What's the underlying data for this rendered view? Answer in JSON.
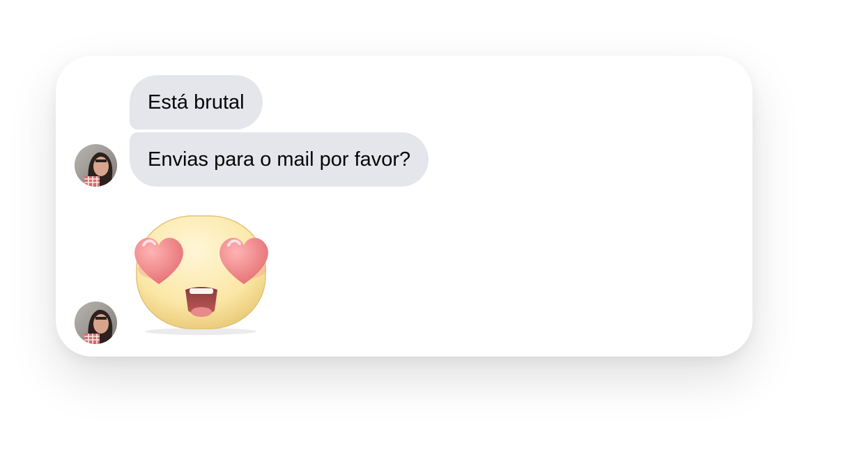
{
  "conversation": {
    "messages": [
      {
        "sender": "contact",
        "type": "text",
        "text": "Está brutal"
      },
      {
        "sender": "contact",
        "type": "text",
        "text": "Envias para o mail por favor?"
      },
      {
        "sender": "contact",
        "type": "sticker",
        "sticker": "heart-eyes-emoji-sticker"
      }
    ]
  },
  "colors": {
    "bubble_bg": "#e4e6eb",
    "text": "#050505",
    "card_bg": "#ffffff"
  }
}
